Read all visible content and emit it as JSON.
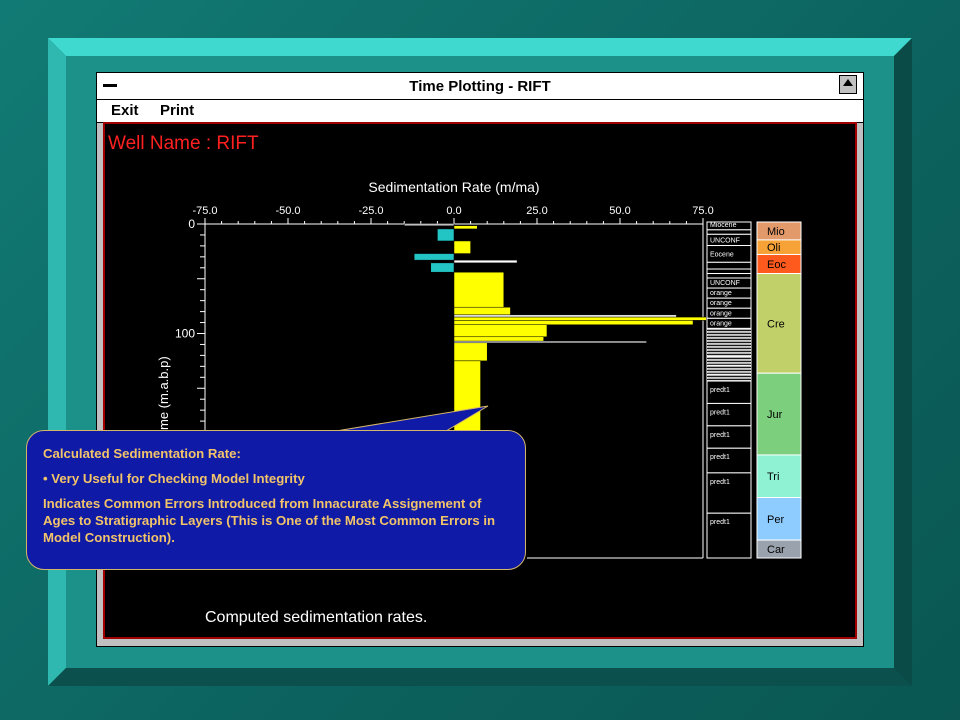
{
  "window": {
    "title": "Time Plotting - RIFT",
    "menu": [
      "Exit",
      "Print"
    ]
  },
  "well_label": "Well Name : RIFT",
  "caption": "Computed sedimentation rates.",
  "chart_data": {
    "type": "bar",
    "title": "Sedimentation Rate (m/ma)",
    "ylabel": "me (m.a.b.p)",
    "x_ticks": [
      "-75.0",
      "-50.0",
      "-25.0",
      "0.0",
      "25.0",
      "50.0",
      "75.0"
    ],
    "xlim": [
      -75,
      75
    ],
    "y_ticks": [
      "0",
      "100"
    ],
    "y_units_per_100": 100,
    "grid": false,
    "intervals": [
      {
        "top": 0,
        "bottom": 1.5,
        "rate": -15
      },
      {
        "top": 1.5,
        "bottom": 4.5,
        "rate": 7
      },
      {
        "top": 4.5,
        "bottom": 15.5,
        "rate": -5
      },
      {
        "top": 15.5,
        "bottom": 27,
        "rate": 5
      },
      {
        "top": 27,
        "bottom": 33,
        "rate": -12
      },
      {
        "top": 33,
        "bottom": 35.5,
        "rate": 19
      },
      {
        "top": 35.5,
        "bottom": 44,
        "rate": -7
      },
      {
        "top": 44,
        "bottom": 76,
        "rate": 15
      },
      {
        "top": 76,
        "bottom": 83,
        "rate": 17
      },
      {
        "top": 83,
        "bottom": 85,
        "rate": 67
      },
      {
        "top": 85,
        "bottom": 88,
        "rate": 76
      },
      {
        "top": 88,
        "bottom": 92,
        "rate": 72
      },
      {
        "top": 92,
        "bottom": 103,
        "rate": 28
      },
      {
        "top": 103,
        "bottom": 107,
        "rate": 27
      },
      {
        "top": 107,
        "bottom": 108.5,
        "rate": 58
      },
      {
        "top": 108.5,
        "bottom": 125,
        "rate": 10
      },
      {
        "top": 125,
        "bottom": 190,
        "rate": 8
      }
    ],
    "positive_color": "#ffff00",
    "negative_color": "#22c4c4"
  },
  "formation_column": [
    {
      "label": "Miocene",
      "top": 0,
      "bottom": 7
    },
    {
      "label": "",
      "top": 7,
      "bottom": 11
    },
    {
      "label": "UNCONF",
      "top": 11,
      "bottom": 21
    },
    {
      "label": "Eocene",
      "top": 21,
      "bottom": 36
    },
    {
      "label": "",
      "top": 36,
      "bottom": 42
    },
    {
      "label": "",
      "top": 42,
      "bottom": 46
    },
    {
      "label": "",
      "top": 46,
      "bottom": 50
    },
    {
      "label": "UNCONF",
      "top": 50,
      "bottom": 59
    },
    {
      "label": "orange",
      "top": 59,
      "bottom": 68
    },
    {
      "label": "orange",
      "top": 68,
      "bottom": 77
    },
    {
      "label": "orange",
      "top": 77,
      "bottom": 86
    },
    {
      "label": "orange",
      "top": 86,
      "bottom": 95
    },
    {
      "label": "",
      "top": 95,
      "bottom": 120
    },
    {
      "label": "",
      "top": 120,
      "bottom": 128
    },
    {
      "label": "",
      "top": 128,
      "bottom": 136
    },
    {
      "label": "",
      "top": 136,
      "bottom": 142
    },
    {
      "label": "predt1",
      "top": 142,
      "bottom": 162
    },
    {
      "label": "predt1",
      "top": 162,
      "bottom": 182
    },
    {
      "label": "predt1",
      "top": 182,
      "bottom": 202
    },
    {
      "label": "predt1",
      "top": 202,
      "bottom": 224
    },
    {
      "label": "predt1",
      "top": 224,
      "bottom": 260
    },
    {
      "label": "predt1",
      "top": 260,
      "bottom": 300
    }
  ],
  "age_column": [
    {
      "label": "Mio",
      "color": "#e29a6a",
      "top": 0,
      "bottom": 16
    },
    {
      "label": "Oli",
      "color": "#f6a236",
      "top": 16,
      "bottom": 29
    },
    {
      "label": "Eoc",
      "color": "#ff5a1e",
      "top": 29,
      "bottom": 46
    },
    {
      "label": "Cre",
      "color": "#c2d06a",
      "top": 46,
      "bottom": 135
    },
    {
      "label": "Jur",
      "color": "#7ccf7c",
      "top": 135,
      "bottom": 208
    },
    {
      "label": "Tri",
      "color": "#8ff2d2",
      "top": 208,
      "bottom": 246
    },
    {
      "label": "Per",
      "color": "#8ecbff",
      "top": 246,
      "bottom": 284
    },
    {
      "label": "Car",
      "color": "#9aa3ad",
      "top": 284,
      "bottom": 300
    }
  ],
  "callout": {
    "heading": "Calculated Sedimentation Rate:",
    "bullet": "• Very Useful for Checking Model Integrity",
    "body": "Indicates Common Errors Introduced from Innacurate Assignement of Ages to Stratigraphic Layers (This is One of the Most Common Errors in Model Construction)."
  }
}
